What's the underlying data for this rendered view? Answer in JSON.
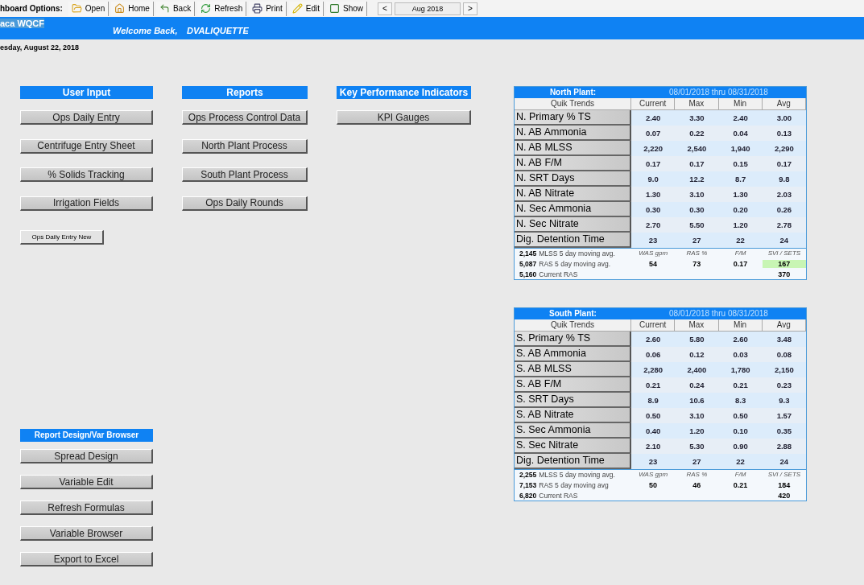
{
  "toolbar": {
    "label": "hboard Options:",
    "buttons": [
      {
        "kind": "open",
        "label": "Open"
      },
      {
        "kind": "home",
        "label": "Home"
      },
      {
        "kind": "back",
        "label": "Back"
      },
      {
        "kind": "refresh",
        "label": "Refresh"
      },
      {
        "kind": "print",
        "label": "Print"
      },
      {
        "kind": "edit",
        "label": "Edit"
      },
      {
        "kind": "show",
        "label": "Show"
      }
    ],
    "prev": "<",
    "period": "Aug 2018",
    "next": ">"
  },
  "banner": {
    "site": "aca WQCF",
    "welcome": "Welcome Back,",
    "user": "DVALIQUETTE"
  },
  "date": "esday, August 22, 2018",
  "sections": [
    {
      "title": "User Input",
      "buttons": [
        "Ops Daily Entry",
        "Centrifuge Entry Sheet",
        "% Solids Tracking",
        "Irrigation Fields"
      ],
      "extra_button": "Ops Daily Entry New"
    },
    {
      "title": "Reports",
      "buttons": [
        "Ops Process Control Data",
        "North Plant Process",
        "South Plant Process",
        "Ops Daily Rounds"
      ]
    },
    {
      "title": "Key Performance Indicators",
      "buttons": [
        "KPI Gauges"
      ]
    }
  ],
  "design": {
    "title": "Report Design/Var Browser",
    "buttons": [
      "Spread Design",
      "Variable Edit",
      "Refresh Formulas",
      "Variable Browser",
      "Export to Excel"
    ]
  },
  "plants": [
    {
      "title": "North Plant:",
      "period": "08/01/2018 thru 08/31/2018",
      "columns": [
        "Quik Trends",
        "Current",
        "Max",
        "Min",
        "Avg"
      ],
      "rows": [
        {
          "label": "N. Primary % TS",
          "values": [
            "2.40",
            "3.30",
            "2.40",
            "3.00"
          ]
        },
        {
          "label": "N. AB Ammonia",
          "values": [
            "0.07",
            "0.22",
            "0.04",
            "0.13"
          ]
        },
        {
          "label": "N. AB MLSS",
          "values": [
            "2,220",
            "2,540",
            "1,940",
            "2,290"
          ]
        },
        {
          "label": "N. AB F/M",
          "values": [
            "0.17",
            "0.17",
            "0.15",
            "0.17"
          ]
        },
        {
          "label": "N. SRT Days",
          "values": [
            "9.0",
            "12.2",
            "8.7",
            "9.8"
          ]
        },
        {
          "label": "N. AB Nitrate",
          "values": [
            "1.30",
            "3.10",
            "1.30",
            "2.03"
          ]
        },
        {
          "label": "N. Sec Ammonia",
          "values": [
            "0.30",
            "0.30",
            "0.20",
            "0.26"
          ]
        },
        {
          "label": "N. Sec Nitrate",
          "values": [
            "2.70",
            "5.50",
            "1.20",
            "2.78"
          ]
        },
        {
          "label": "Dig. Detention Time",
          "values": [
            "23",
            "27",
            "22",
            "24"
          ]
        }
      ],
      "stats": [
        {
          "figure": "2,145",
          "caption": "MLSS 5 day moving avg."
        },
        {
          "figure": "5,087",
          "caption": "RAS 5 day moving avg."
        },
        {
          "figure": "5,160",
          "caption": "Current RAS"
        }
      ],
      "kpis": [
        {
          "heading": "WAS gpm",
          "value": "54",
          "highlight": false
        },
        {
          "heading": "RAS %",
          "value": "73",
          "highlight": false
        },
        {
          "heading": "F/M",
          "value": "0.17",
          "highlight": false
        },
        {
          "heading": "SVI / SETS",
          "value": "167",
          "extra": "370",
          "highlight": true
        }
      ]
    },
    {
      "title": "South Plant:",
      "period": "08/01/2018 thru 08/31/2018",
      "columns": [
        "Quik Trends",
        "Current",
        "Max",
        "Min",
        "Avg"
      ],
      "rows": [
        {
          "label": "S. Primary % TS",
          "values": [
            "2.60",
            "5.80",
            "2.60",
            "3.48"
          ]
        },
        {
          "label": "S. AB Ammonia",
          "values": [
            "0.06",
            "0.12",
            "0.03",
            "0.08"
          ]
        },
        {
          "label": "S. AB MLSS",
          "values": [
            "2,280",
            "2,400",
            "1,780",
            "2,150"
          ]
        },
        {
          "label": "S. AB F/M",
          "values": [
            "0.21",
            "0.24",
            "0.21",
            "0.23"
          ]
        },
        {
          "label": "S. SRT Days",
          "values": [
            "8.9",
            "10.6",
            "8.3",
            "9.3"
          ]
        },
        {
          "label": "S. AB Nitrate",
          "values": [
            "0.50",
            "3.10",
            "0.50",
            "1.57"
          ]
        },
        {
          "label": "S. Sec Ammonia",
          "values": [
            "0.40",
            "1.20",
            "0.10",
            "0.35"
          ]
        },
        {
          "label": "S. Sec Nitrate",
          "values": [
            "2.10",
            "5.30",
            "0.90",
            "2.88"
          ]
        },
        {
          "label": "Dig. Detention Time",
          "values": [
            "23",
            "27",
            "22",
            "24"
          ]
        }
      ],
      "stats": [
        {
          "figure": "2,255",
          "caption": "MLSS 5 day moving avg."
        },
        {
          "figure": "7,153",
          "caption": "RAS 5 day moving avg"
        },
        {
          "figure": "6,820",
          "caption": "Current RAS"
        }
      ],
      "kpis": [
        {
          "heading": "WAS gpm",
          "value": "50",
          "highlight": false
        },
        {
          "heading": "RAS %",
          "value": "46",
          "highlight": false
        },
        {
          "heading": "F/M",
          "value": "0.21",
          "highlight": false
        },
        {
          "heading": "SVI / SETS",
          "value": "184",
          "extra": "420",
          "highlight": false
        }
      ]
    }
  ]
}
